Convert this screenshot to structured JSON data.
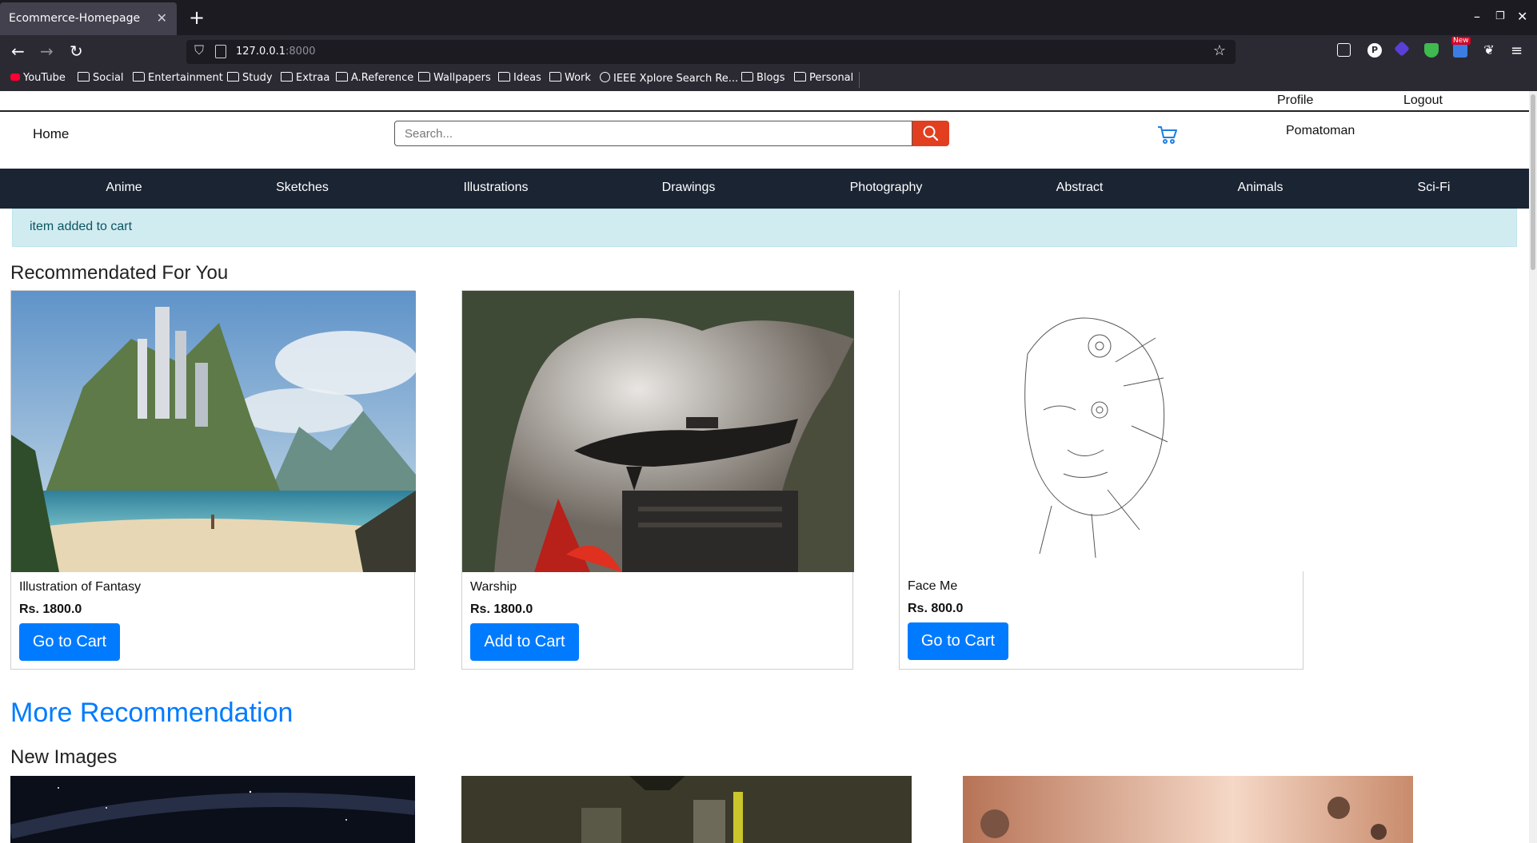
{
  "browser": {
    "tab_title": "Ecommerce-Homepage",
    "url_host": "127.0.0.1",
    "url_port": ":8000",
    "bookmarks": [
      "YouTube",
      "Social",
      "Entertainment",
      "Study",
      "Extraa",
      "A.Reference",
      "Wallpapers",
      "Ideas",
      "Work",
      "IEEE Xplore Search Re...",
      "Blogs",
      "Personal"
    ],
    "ext_badge": "New"
  },
  "header": {
    "profile": "Profile",
    "logout": "Logout",
    "home": "Home",
    "search_placeholder": "Search...",
    "username": "Pomatoman"
  },
  "categories": [
    "Anime",
    "Sketches",
    "Illustrations",
    "Drawings",
    "Photography",
    "Abstract",
    "Animals",
    "Sci-Fi"
  ],
  "alert": "item added to cart",
  "recommended": {
    "title": "Recommendated For You",
    "items": [
      {
        "name": "Illustration of Fantasy",
        "price": "Rs. 1800.0",
        "button": "Go to Cart"
      },
      {
        "name": "Warship",
        "price": "Rs. 1800.0",
        "button": "Add to Cart"
      },
      {
        "name": "Face Me",
        "price": "Rs. 800.0",
        "button": "Go to Cart"
      }
    ]
  },
  "more_recommendation": "More Recommendation",
  "new_images_title": "New Images",
  "colors": {
    "accent": "#007bff",
    "nav_bg": "#1a2433",
    "search_button": "#e13f1f",
    "alert_bg": "#d1ecf1"
  }
}
